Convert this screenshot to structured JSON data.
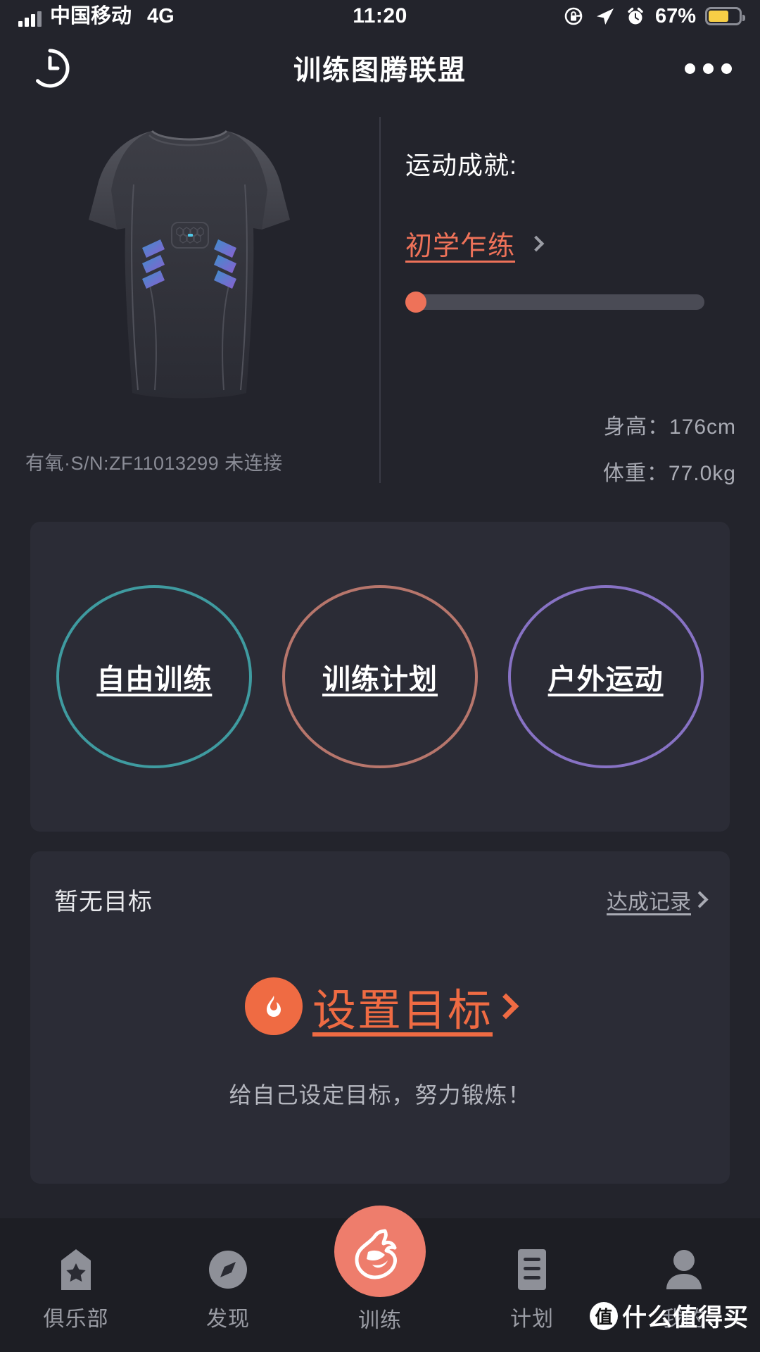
{
  "status_bar": {
    "carrier": "中国移动",
    "network": "4G",
    "time": "11:20",
    "battery_percent": "67%",
    "battery_level": 67,
    "icons": [
      "signal-icon",
      "rotation-lock-icon",
      "location-arrow-icon",
      "alarm-clock-icon",
      "battery-icon"
    ],
    "battery_color": "#f7ce46"
  },
  "header": {
    "title": "训练图腾联盟",
    "history_icon": "clock-history-icon",
    "more_icon": "more-options-icon"
  },
  "device": {
    "info_line": "有氧·S/N:ZF11013299 未连接",
    "image": "smart-training-shirt"
  },
  "achievement": {
    "label": "运动成就:",
    "level": "初学乍练",
    "level_color": "#ee7259",
    "progress_percent": 2,
    "chevron_icon": "chevron-right-icon"
  },
  "body_stats": [
    {
      "label": "身高：",
      "value": "176cm"
    },
    {
      "label": "体重：",
      "value": "77.0kg"
    }
  ],
  "modes": [
    {
      "label": "自由训练",
      "color": "#3f9ba0",
      "name": "free-training"
    },
    {
      "label": "训练计划",
      "color": "#b7766c",
      "name": "training-plan"
    },
    {
      "label": "户外运动",
      "color": "#8772c4",
      "name": "outdoor-sport"
    }
  ],
  "goal": {
    "empty_label": "暂无目标",
    "record_link": "达成记录",
    "set_goal_label": "设置目标",
    "set_goal_color": "#ef6b43",
    "flame_icon": "flame-icon",
    "subtitle": "给自己设定目标，努力锻炼！"
  },
  "tabs": [
    {
      "label": "俱乐部",
      "icon": "badge-star-icon",
      "active": false
    },
    {
      "label": "发现",
      "icon": "compass-icon",
      "active": false
    },
    {
      "label": "训练",
      "icon": "flame-logo-icon",
      "active": true
    },
    {
      "label": "计划",
      "icon": "list-icon",
      "active": false
    },
    {
      "label": "我的",
      "icon": "person-icon",
      "active": false
    }
  ],
  "watermark": {
    "badge": "值",
    "text": "什么值得买"
  }
}
